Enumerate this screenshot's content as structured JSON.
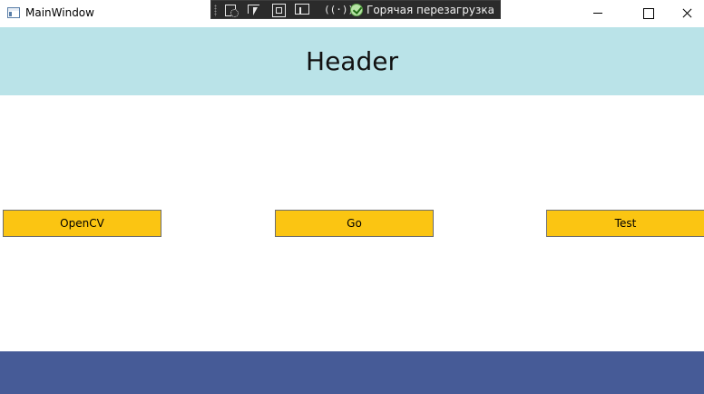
{
  "window": {
    "title": "MainWindow",
    "icon": "app-window-icon",
    "controls": [
      "minimize-icon",
      "maximize-icon",
      "close-icon"
    ]
  },
  "debug_toolbar": {
    "tools": [
      "select-element-icon",
      "display-adorners-icon",
      "track-focus-icon",
      "hot-reload-icon"
    ],
    "status_text": "Горячая перезагрузка",
    "collapse_glyph": "‹"
  },
  "header": {
    "title": "Header",
    "background": "#bae3e8"
  },
  "buttons": [
    {
      "label": "OpenCV"
    },
    {
      "label": "Go"
    },
    {
      "label": "Test"
    }
  ],
  "colors": {
    "button_fill": "#fbc512",
    "footer": "#465b97"
  }
}
